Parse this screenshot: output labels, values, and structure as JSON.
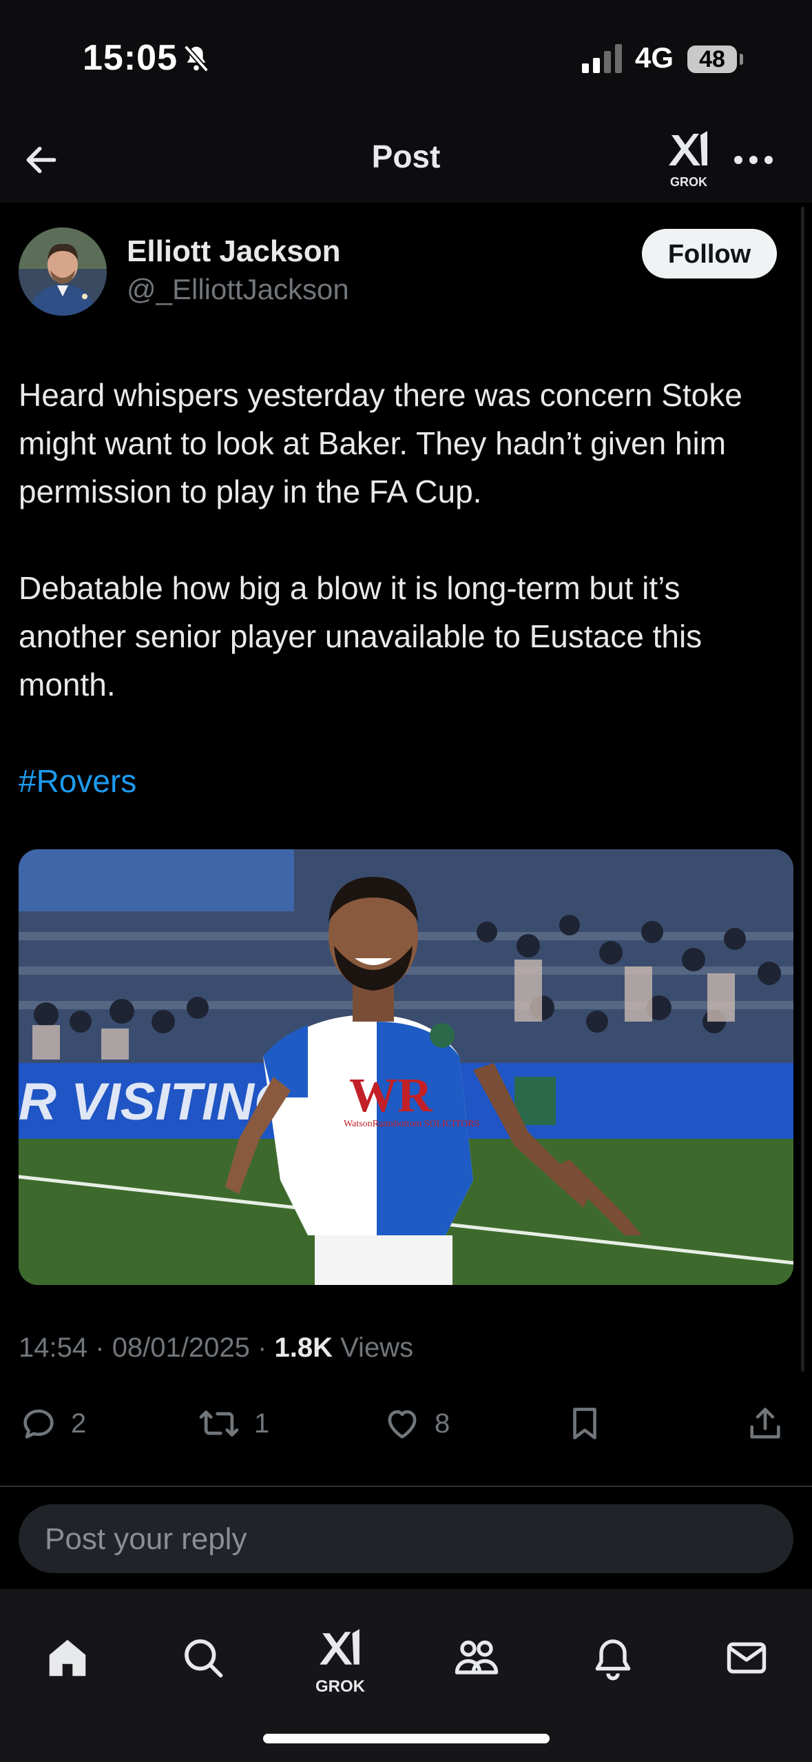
{
  "status_bar": {
    "time": "15:05",
    "network": "4G",
    "battery": "48"
  },
  "header": {
    "title": "Post",
    "grok_label": "GROK"
  },
  "author": {
    "name": "Elliott Jackson",
    "handle": "@_ElliottJackson",
    "follow_label": "Follow"
  },
  "post": {
    "paragraphs": [
      "Heard whispers yesterday there was concern Stoke might want to look at Baker. They hadn’t given him permission to play in the FA Cup.",
      "Debatable how big a blow it is long-term but it’s another senior player unavailable to Eustace this month."
    ],
    "hashtag": "#Rovers",
    "image": {
      "banner_text": "R VISITING EW",
      "sponsor": "WR",
      "sponsor_sub": "WatsonRamsbottom SOLICITORS"
    },
    "time": "14:54",
    "date": "08/01/2025",
    "views_count": "1.8K",
    "views_label": "Views",
    "separator": "·"
  },
  "actions": {
    "replies": "2",
    "reposts": "1",
    "likes": "8"
  },
  "reply": {
    "placeholder": "Post your reply"
  },
  "nav": {
    "grok_label": "GROK"
  },
  "colors": {
    "accent": "#1d9bf0",
    "muted": "#71767b",
    "background": "#000000"
  }
}
